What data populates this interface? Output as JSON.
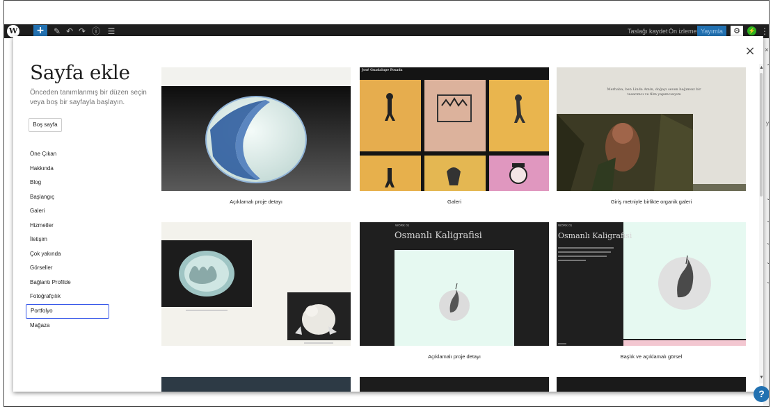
{
  "toolbar": {
    "save_draft": "Taslağı kaydet",
    "preview": "Ön izleme",
    "publish": "Yayımla"
  },
  "modal": {
    "title": "Sayfa ekle",
    "description": "Önceden tanımlanmış bir düzen seçin veya boş bir sayfayla başlayın.",
    "blank_button": "Boş sayfa",
    "categories": [
      "Öne Çıkan",
      "Hakkında",
      "Blog",
      "Başlangıç",
      "Galeri",
      "Hizmetler",
      "İletişim",
      "Çok yakında",
      "Görseller",
      "Bağlantı Profilde",
      "Fotoğrafçılık",
      "Portfolyo",
      "Mağaza"
    ],
    "selected_category": "Portfolyo",
    "patterns": [
      {
        "caption": "Açıklamalı proje detayı"
      },
      {
        "caption": "Galeri",
        "header": "José Guadalupe Posada"
      },
      {
        "caption": "Giriş metniyle birlikte organik galeri",
        "intro": "Merhaba, ben Linda Amin, doğayı seven bağımsız bir tasarımcı ve film yapımcısıyım"
      },
      {
        "caption": "",
        "label1": "",
        "label2": ""
      },
      {
        "caption": "Açıklamalı proje detayı",
        "work": "WORK 01",
        "heading": "Osmanlı Kaligrafisi"
      },
      {
        "caption": "Başlık ve açıklamalı görsel",
        "work": "WORK 01",
        "heading": "Osmanlı Kaligrafisi",
        "blurb": ""
      }
    ]
  },
  "colors": {
    "admin_bar": "#1e1e1e",
    "accent": "#2271b1",
    "active_outline": "#3858e9",
    "mint": "#e6f9f1",
    "dark": "#1f1f1f"
  }
}
